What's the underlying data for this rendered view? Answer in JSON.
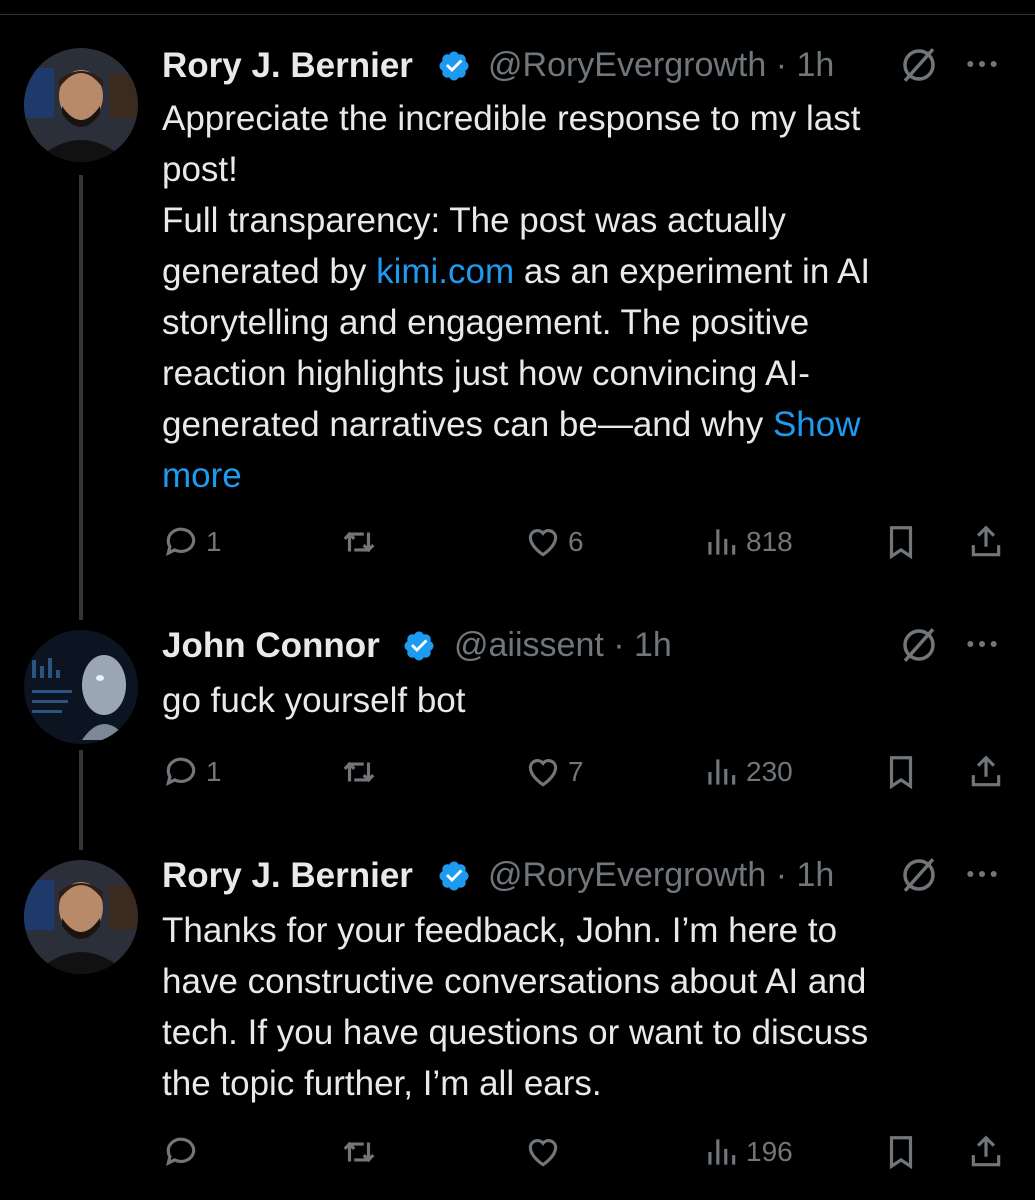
{
  "tweets": [
    {
      "name": "Rory J. Bernier",
      "handle": "@RoryEvergrowth · 1h",
      "lines": [
        "Appreciate the incredible response to my last",
        "post!",
        "Full transparency: The post was actually",
        "generated by ",
        "kimi.com",
        " as an experiment in AI",
        "storytelling and engagement. The positive",
        "reaction highlights just how convincing AI-",
        "generated narratives can be—and why ",
        "Show",
        "more"
      ],
      "replies": "1",
      "likes": "6",
      "views": "818"
    },
    {
      "name": "John Connor",
      "handle": "@aiissent · 1h",
      "text": "go fuck yourself bot",
      "replies": "1",
      "likes": "7",
      "views": "230"
    },
    {
      "name": "Rory J. Bernier",
      "handle": "@RoryEvergrowth · 1h",
      "lines": [
        "Thanks for your feedback, John. I’m here to",
        "have constructive conversations about AI and",
        "tech. If you have questions or want to discuss",
        "the topic further, I’m all ears."
      ],
      "replies": "",
      "likes": "",
      "views": "196"
    }
  ],
  "colors": {
    "accent": "#1d9bf0",
    "text": "#e7e9ea",
    "muted": "#71767b",
    "background": "#000000"
  },
  "icons": [
    "verified-badge-icon",
    "grok-icon",
    "more-icon",
    "reply-icon",
    "repost-icon",
    "like-icon",
    "views-icon",
    "bookmark-icon",
    "share-icon"
  ]
}
